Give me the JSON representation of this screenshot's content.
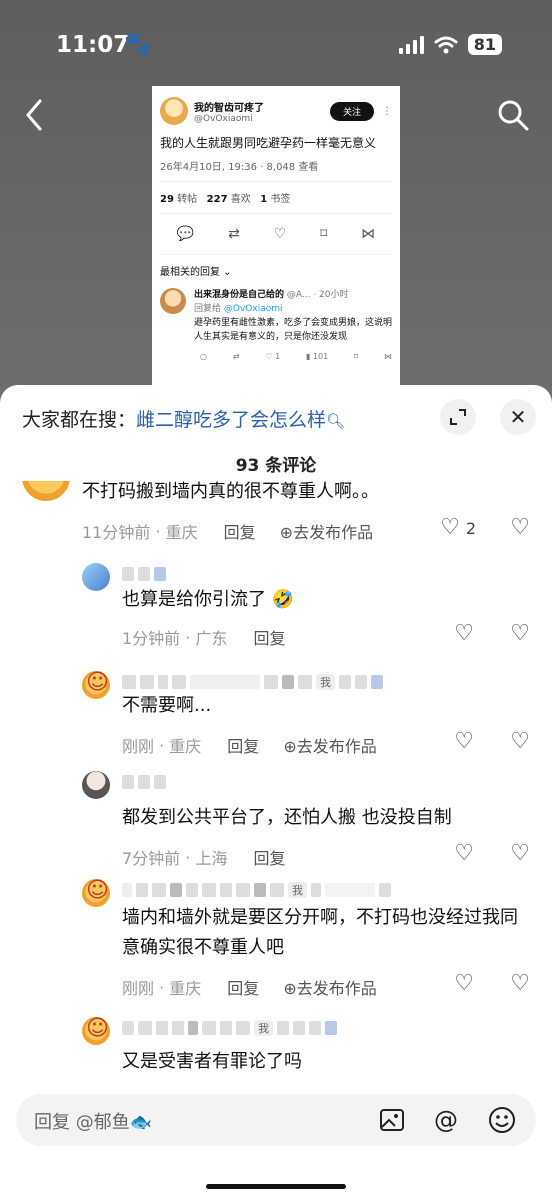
{
  "status": {
    "time": "11:07",
    "battery": "81"
  },
  "tweet": {
    "name": "我的智齿可疼了",
    "handle": "@OvOxiaomi",
    "follow_label": "关注",
    "text": "我的人生就跟男同吃避孕药一样毫无意义",
    "meta": "26年4月10日, 19:36 · 8,048 查看",
    "retweets": "29",
    "retweets_label": "转帖",
    "likes": "227",
    "likes_label": "喜欢",
    "bookmarks": "1",
    "bookmarks_label": "书签",
    "sort_label": "最相关的回复",
    "reply": {
      "name": "出来混身份是自己给的",
      "handle_time": "@A... · 20小时",
      "reply_to_prefix": "回复给",
      "reply_to": "@OvOxiaomi",
      "text": "避孕药里有雌性激素，吃多了会变成男娘，这说明人生其实是有意义的，只是你还没发现",
      "like_count": "1",
      "view_count": "101"
    }
  },
  "sheet": {
    "search_prefix": "大家都在搜：",
    "search_term": "雌二醇吃多了会怎么样",
    "comment_count_title": "93 条评论",
    "me_tag": "我"
  },
  "comments": [
    {
      "text": "不打码搬到墙内真的很不尊重人啊。。",
      "time": "11分钟前",
      "location": "重庆",
      "reply": "回复",
      "publish": "去发布作品",
      "likes": "2"
    },
    {
      "text": "也算是给你引流了 🤣",
      "time": "1分钟前",
      "location": "广东",
      "reply": "回复"
    },
    {
      "text": "不需要啊...",
      "time": "刚刚",
      "location": "重庆",
      "reply": "回复",
      "publish": "去发布作品"
    },
    {
      "text": "都发到公共平台了，还怕人搬 也没投自制",
      "time": "7分钟前",
      "location": "上海",
      "reply": "回复"
    },
    {
      "text": "墙内和墙外就是要区分开啊，不打码也没经过我同意确实很不尊重人吧",
      "time": "刚刚",
      "location": "重庆",
      "reply": "回复",
      "publish": "去发布作品"
    },
    {
      "text": "又是受害者有罪论了吗"
    }
  ],
  "input": {
    "placeholder": "回复 @郁鱼🐟"
  },
  "icons": {
    "back": "chevron-left-icon",
    "search": "search-icon",
    "expand": "expand-icon",
    "close": "close-icon",
    "image": "image-icon",
    "mention": "at-icon",
    "emoji": "emoji-icon",
    "like": "heart-icon",
    "dislike": "broken-heart-icon"
  }
}
